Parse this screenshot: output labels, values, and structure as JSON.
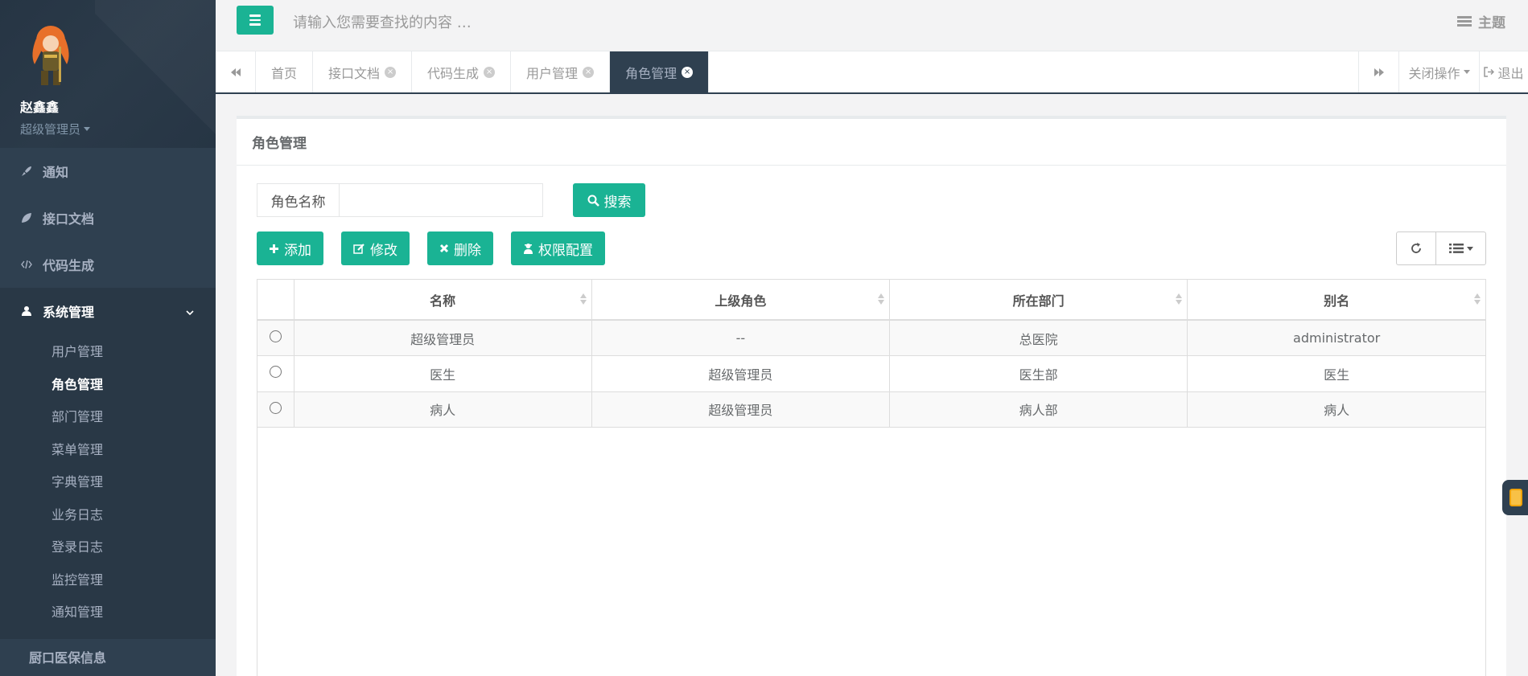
{
  "sidebar": {
    "user_name": "赵鑫鑫",
    "user_role": "超级管理员",
    "menu": [
      {
        "label": "通知",
        "icon": "rocket-icon"
      },
      {
        "label": "接口文档",
        "icon": "leaf-icon"
      },
      {
        "label": "代码生成",
        "icon": "code-icon"
      },
      {
        "label": "系统管理",
        "icon": "user-icon"
      }
    ],
    "submenu": [
      "用户管理",
      "角色管理",
      "部门管理",
      "菜单管理",
      "字典管理",
      "业务日志",
      "登录日志",
      "监控管理",
      "通知管理"
    ],
    "bottom_item": "厨口医保信息"
  },
  "header": {
    "search_placeholder": "请输入您需要查找的内容 …",
    "theme_label": "主题"
  },
  "tabs": {
    "items": [
      "首页",
      "接口文档",
      "代码生成",
      "用户管理",
      "角色管理"
    ],
    "close_ops": "关闭操作",
    "logout": "退出"
  },
  "page": {
    "title": "角色管理",
    "search_label": "角色名称",
    "search_value": "",
    "search_button": "搜索",
    "add_button": "添加",
    "edit_button": "修改",
    "delete_button": "删除",
    "permission_button": "权限配置"
  },
  "table": {
    "columns": [
      "名称",
      "上级角色",
      "所在部门",
      "别名"
    ],
    "rows": [
      [
        "超级管理员",
        "--",
        "总医院",
        "administrator"
      ],
      [
        "医生",
        "超级管理员",
        "医生部",
        "医生"
      ],
      [
        "病人",
        "超级管理员",
        "病人部",
        "病人"
      ]
    ]
  },
  "colors": {
    "accent": "#1ab394",
    "sidebar_bg": "#2f4050"
  }
}
